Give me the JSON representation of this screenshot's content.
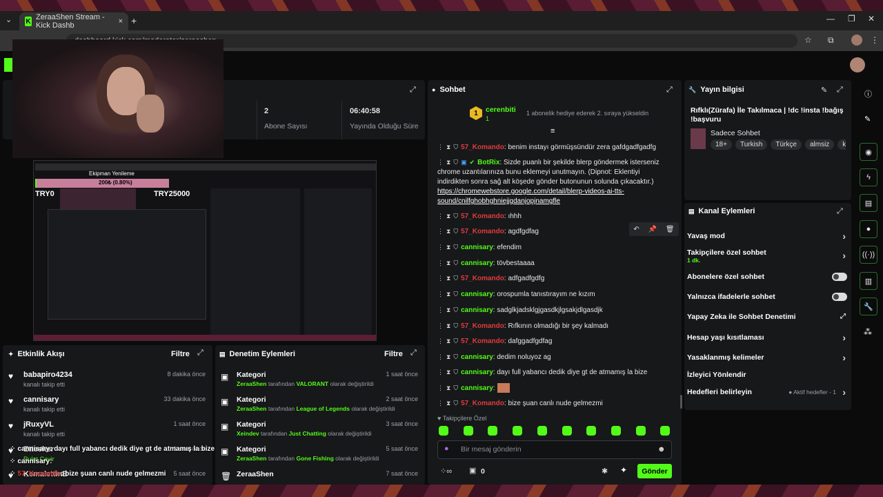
{
  "browser": {
    "tab_title": "ZeraaShen Stream - Kick Dashb",
    "url": "dashboard.kick.com/moderator/zeraashen"
  },
  "stats": {
    "subscribers_value": "2",
    "subscribers_label": "Abone Sayısı",
    "uptime_value": "06:40:58",
    "uptime_label": "Yayında Olduğu Süre"
  },
  "chat": {
    "title": "Sohbet",
    "pinned_user": "cerenbiti",
    "pinned_count": "1",
    "pinned_text": "1 abonelik hediye ederek 2. sıraya yükseldin",
    "messages": [
      {
        "user": "57_Komando",
        "color": "red",
        "text": ": benim instayı görmüşsündür zera gafdgadfgadfg"
      },
      {
        "user": "BotRix",
        "color": "green",
        "text": ": Sizde puanlı bir şekilde blerp göndermek isterseniz chrome uzantılarınıza bunu eklemeyi unutmayın. (Dipnot: Eklentiyi indirdikten sonra sağ alt köşede gönder butonunun solunda çıkacaktır.)"
      },
      {
        "user": "57_Komando",
        "color": "red",
        "text": ": ıhhh"
      },
      {
        "user": "57_Komando",
        "color": "red",
        "text": ": agdfgdfag"
      },
      {
        "user": "cannisary",
        "color": "green",
        "text": ": efendim"
      },
      {
        "user": "cannisary",
        "color": "green",
        "text": ": tövbestaaaa"
      },
      {
        "user": "57_Komando",
        "color": "red",
        "text": ": adfgadfgdfg"
      },
      {
        "user": "cannisary",
        "color": "green",
        "text": ": orospumla tanıstırayım ne kızım"
      },
      {
        "user": "cannisary",
        "color": "green",
        "text": ": sadglkjadsklgjgasdkjlgsakjdlgasdjk"
      },
      {
        "user": "57_Komando",
        "color": "red",
        "text": ": Rıfkının olmadığı bir şey kalmadı"
      },
      {
        "user": "57_Komando",
        "color": "red",
        "text": ": dafggadfgdfag"
      },
      {
        "user": "cannisary",
        "color": "green",
        "text": ": dedim noluyoz ag"
      },
      {
        "user": "cannisary",
        "color": "green",
        "text": ": dayı full yabancı dedik diye gt de atmamış la bize"
      },
      {
        "user": "cannisary",
        "color": "green",
        "text": ":"
      },
      {
        "user": "57_Komando",
        "color": "red",
        "text": ": bize şuan canlı nude gelmezmi"
      }
    ],
    "botrix_link": "https://chromewebstore.google.com/detail/blerp-videos-ai-tts-sound/cnilfghobhghniejjgdanjopjnamgfle",
    "followers_only_label": "Takipçilere Özel",
    "input_placeholder": "Bir mesaj gönderin",
    "points": "0",
    "send_label": "Gönder"
  },
  "stream_info": {
    "title": "Yayın bilgisi",
    "stream_title": "Rıfklı(Zürafa) İle Takılmaca | !dc !insta !bağış !başvuru",
    "category": "Sadece Sohbet",
    "tags": [
      "18+",
      "Turkish",
      "Türkçe",
      "almsiz",
      "küfü"
    ]
  },
  "channel_actions": {
    "title": "Kanal Eylemleri",
    "items": [
      {
        "label": "Yavaş mod",
        "type": "chevron"
      },
      {
        "label": "Takipçilere özel sohbet",
        "sub": "1 dk.",
        "type": "chevron"
      },
      {
        "label": "Abonelere özel sohbet",
        "type": "toggle"
      },
      {
        "label": "Yalnızca ifadelerle sohbet",
        "type": "toggle"
      },
      {
        "label": "Yapay Zeka ile Sohbet Denetimi",
        "type": "external"
      },
      {
        "label": "Hesap yaşı kısıtlaması",
        "type": "chevron"
      },
      {
        "label": "Yasaklanmış kelimeler",
        "type": "chevron"
      },
      {
        "label": "İzleyici Yönlendir",
        "type": "none"
      },
      {
        "label": "Hedefleri belirleyin",
        "sub": "Aktif hedefler - 1",
        "type": "chevron"
      }
    ]
  },
  "activity": {
    "title": "Etkinlik Akışı",
    "filter": "Filtre",
    "items": [
      {
        "name": "babapiro4234",
        "sub": "kanalı takip etti",
        "time": "8 dakika önce"
      },
      {
        "name": "cannisary",
        "sub": "kanalı takip etti",
        "time": "33 dakika önce"
      },
      {
        "name": "jRuxyVL",
        "sub": "kanalı takip etti",
        "time": "1 saat önce"
      },
      {
        "name": "Ettesher",
        "sub": "Rulet Çevir",
        "time": "1 saat önce"
      },
      {
        "name": "KemalettinE",
        "sub": "",
        "time": "5 saat önce"
      }
    ],
    "overlay_lines": [
      {
        "user": "cannisary",
        "text": ": dayı full yabancı dedik diye gt de atmamış la bize"
      },
      {
        "user": "cannisary",
        "text": ":"
      },
      {
        "user": "57_Komando",
        "text": ": bize şuan canlı nude gelmezmi"
      }
    ]
  },
  "moderation": {
    "title": "Denetim Eylemleri",
    "filter": "Filtre",
    "items": [
      {
        "title": "Kategori",
        "actor": "ZeraaShen",
        "mid": " tarafından ",
        "value": "VALORANT",
        "end": " olarak değiştirildi",
        "time": "1 saat önce"
      },
      {
        "title": "Kategori",
        "actor": "ZeraaShen",
        "mid": " tarafından ",
        "value": "League of Legends",
        "end": " olarak değiştirildi",
        "time": "2 saat önce"
      },
      {
        "title": "Kategori",
        "actor": "Xeindev",
        "mid": " tarafından ",
        "value": "Just Chatting",
        "end": " olarak değiştirildi",
        "time": "3 saat önce"
      },
      {
        "title": "Kategori",
        "actor": "ZeraaShen",
        "mid": " tarafından ",
        "value": "Gone Fishing",
        "end": " olarak değiştirildi",
        "time": "5 saat önce"
      },
      {
        "title": "ZeraaShen",
        "actor": "",
        "mid": "",
        "value": "",
        "end": "",
        "time": "7 saat önce"
      }
    ]
  },
  "preview": {
    "modal_title": "Ekipman Yenileme",
    "progress_text": "200₺ (0.80%)",
    "progress": 0.008,
    "left_label": "TRY0",
    "right_label": "TRY25000"
  }
}
